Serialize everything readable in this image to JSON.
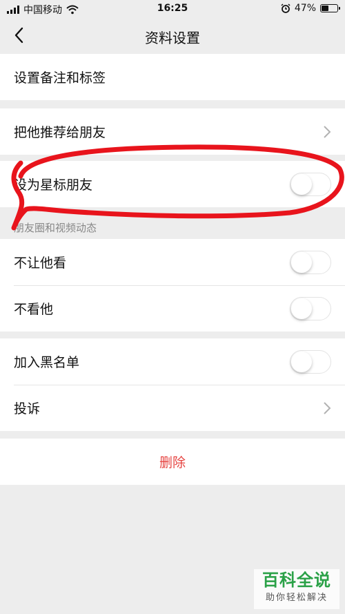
{
  "status_bar": {
    "carrier": "中国移动",
    "time": "16:25",
    "battery_percent": "47%",
    "battery_level": 0.47,
    "icons": [
      "signal-icon",
      "wifi-icon",
      "alarm-icon",
      "battery-icon"
    ]
  },
  "nav": {
    "title": "资料设置",
    "back_icon": "chevron-left-icon"
  },
  "groups": {
    "remark": {
      "label": "设置备注和标签"
    },
    "recommend": {
      "label": "把他推荐给朋友"
    },
    "star": {
      "label": "设为星标朋友",
      "enabled": false
    },
    "moments_header": "朋友圈和视频动态",
    "hide_my_posts": {
      "label": "不让他看",
      "enabled": false
    },
    "hide_his_posts": {
      "label": "不看他",
      "enabled": false
    },
    "blacklist": {
      "label": "加入黑名单",
      "enabled": false
    },
    "report": {
      "label": "投诉"
    },
    "delete": {
      "label": "删除"
    }
  },
  "colors": {
    "background": "#ededed",
    "danger": "#e64340",
    "annotation": "#e8141c",
    "watermark_green": "#2aa147"
  },
  "watermark": {
    "main": "百科全说",
    "sub": "助你轻松解决"
  }
}
